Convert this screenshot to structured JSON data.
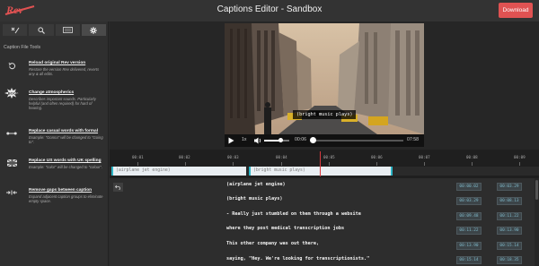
{
  "app": {
    "logo_text": "Rev",
    "title": "Captions Editor - Sandbox",
    "download_label": "Download"
  },
  "sidebar": {
    "tabs": [
      {
        "icon": "magic-wand-icon",
        "active": false
      },
      {
        "icon": "search-icon",
        "active": false
      },
      {
        "icon": "keyboard-icon",
        "active": false
      },
      {
        "icon": "gear-icon",
        "active": true
      }
    ],
    "heading": "Caption File Tools",
    "tools": [
      {
        "icon": "undo-icon",
        "title": "Reload original Rev version",
        "desc": "Restore the version Rev delivered, reverts any & all edits."
      },
      {
        "icon": "boom-icon",
        "title": "Change atmospherics",
        "desc": "Describes important sounds. Particularly helpful (and often required) for hard of hearing."
      },
      {
        "icon": "connector-icon",
        "title": "Replace casual words with formal",
        "desc": "Example: \"Gonna\" will be changed to \"Going to\"."
      },
      {
        "icon": "flag-icon",
        "title": "Replace US words with UK spelling",
        "desc": "Example: \"color\" will be changed to \"colour\"."
      },
      {
        "icon": "merge-icon",
        "title": "Remove gaps between caption",
        "desc": "Expand adjacent caption groups to eliminate empty space."
      }
    ]
  },
  "video": {
    "caption_overlay": "(bright music plays)",
    "speed": "1x",
    "current_time": "00:06",
    "duration": "07:58",
    "volume_level": 0.65,
    "progress_fraction": 0.0
  },
  "timeline": {
    "ticks": [
      "00:01",
      "00:02",
      "00:03",
      "00:04",
      "00:05",
      "00:06",
      "00:07",
      "00:08",
      "00:09"
    ],
    "blocks": [
      {
        "label": "(airplane jet engine)"
      },
      {
        "label": "(bright music plays)"
      }
    ]
  },
  "transcript": {
    "lines": [
      {
        "text": "(airplane jet engine)",
        "start": "00:00.02",
        "end": "00:03.29"
      },
      {
        "text": "(bright music plays)",
        "start": "00:03.29",
        "end": "00:08.13"
      },
      {
        "text": "- Really just stumbled on them through a website",
        "start": "00:09.48",
        "end": "00:11.22"
      },
      {
        "text": "where they post medical transcription jobs",
        "start": "00:11.22",
        "end": "00:13.90"
      },
      {
        "text": "This other company was out there,",
        "start": "00:13.90",
        "end": "00:15.14"
      },
      {
        "text": "saying, \"Hey. We're looking for transcriptionists.\"",
        "start": "00:15.14",
        "end": "00:18.35"
      }
    ]
  },
  "colors": {
    "accent_red": "#e05252",
    "teal": "#2bb5c6",
    "playhead": "#d9393e"
  }
}
